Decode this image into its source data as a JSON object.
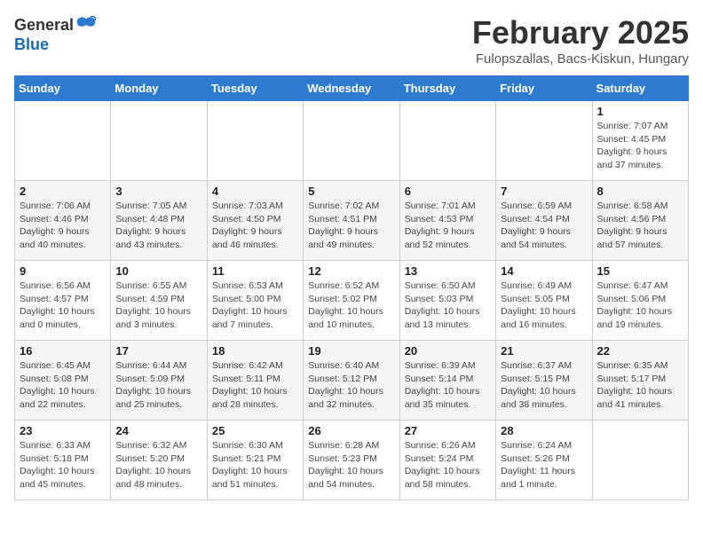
{
  "header": {
    "logo_general": "General",
    "logo_blue": "Blue",
    "month": "February 2025",
    "location": "Fulopszallas, Bacs-Kiskun, Hungary"
  },
  "weekdays": [
    "Sunday",
    "Monday",
    "Tuesday",
    "Wednesday",
    "Thursday",
    "Friday",
    "Saturday"
  ],
  "weeks": [
    [
      {
        "day": "",
        "info": ""
      },
      {
        "day": "",
        "info": ""
      },
      {
        "day": "",
        "info": ""
      },
      {
        "day": "",
        "info": ""
      },
      {
        "day": "",
        "info": ""
      },
      {
        "day": "",
        "info": ""
      },
      {
        "day": "1",
        "info": "Sunrise: 7:07 AM\nSunset: 4:45 PM\nDaylight: 9 hours\nand 37 minutes."
      }
    ],
    [
      {
        "day": "2",
        "info": "Sunrise: 7:06 AM\nSunset: 4:46 PM\nDaylight: 9 hours\nand 40 minutes."
      },
      {
        "day": "3",
        "info": "Sunrise: 7:05 AM\nSunset: 4:48 PM\nDaylight: 9 hours\nand 43 minutes."
      },
      {
        "day": "4",
        "info": "Sunrise: 7:03 AM\nSunset: 4:50 PM\nDaylight: 9 hours\nand 46 minutes."
      },
      {
        "day": "5",
        "info": "Sunrise: 7:02 AM\nSunset: 4:51 PM\nDaylight: 9 hours\nand 49 minutes."
      },
      {
        "day": "6",
        "info": "Sunrise: 7:01 AM\nSunset: 4:53 PM\nDaylight: 9 hours\nand 52 minutes."
      },
      {
        "day": "7",
        "info": "Sunrise: 6:59 AM\nSunset: 4:54 PM\nDaylight: 9 hours\nand 54 minutes."
      },
      {
        "day": "8",
        "info": "Sunrise: 6:58 AM\nSunset: 4:56 PM\nDaylight: 9 hours\nand 57 minutes."
      }
    ],
    [
      {
        "day": "9",
        "info": "Sunrise: 6:56 AM\nSunset: 4:57 PM\nDaylight: 10 hours\nand 0 minutes."
      },
      {
        "day": "10",
        "info": "Sunrise: 6:55 AM\nSunset: 4:59 PM\nDaylight: 10 hours\nand 3 minutes."
      },
      {
        "day": "11",
        "info": "Sunrise: 6:53 AM\nSunset: 5:00 PM\nDaylight: 10 hours\nand 7 minutes."
      },
      {
        "day": "12",
        "info": "Sunrise: 6:52 AM\nSunset: 5:02 PM\nDaylight: 10 hours\nand 10 minutes."
      },
      {
        "day": "13",
        "info": "Sunrise: 6:50 AM\nSunset: 5:03 PM\nDaylight: 10 hours\nand 13 minutes."
      },
      {
        "day": "14",
        "info": "Sunrise: 6:49 AM\nSunset: 5:05 PM\nDaylight: 10 hours\nand 16 minutes."
      },
      {
        "day": "15",
        "info": "Sunrise: 6:47 AM\nSunset: 5:06 PM\nDaylight: 10 hours\nand 19 minutes."
      }
    ],
    [
      {
        "day": "16",
        "info": "Sunrise: 6:45 AM\nSunset: 5:08 PM\nDaylight: 10 hours\nand 22 minutes."
      },
      {
        "day": "17",
        "info": "Sunrise: 6:44 AM\nSunset: 5:09 PM\nDaylight: 10 hours\nand 25 minutes."
      },
      {
        "day": "18",
        "info": "Sunrise: 6:42 AM\nSunset: 5:11 PM\nDaylight: 10 hours\nand 28 minutes."
      },
      {
        "day": "19",
        "info": "Sunrise: 6:40 AM\nSunset: 5:12 PM\nDaylight: 10 hours\nand 32 minutes."
      },
      {
        "day": "20",
        "info": "Sunrise: 6:39 AM\nSunset: 5:14 PM\nDaylight: 10 hours\nand 35 minutes."
      },
      {
        "day": "21",
        "info": "Sunrise: 6:37 AM\nSunset: 5:15 PM\nDaylight: 10 hours\nand 38 minutes."
      },
      {
        "day": "22",
        "info": "Sunrise: 6:35 AM\nSunset: 5:17 PM\nDaylight: 10 hours\nand 41 minutes."
      }
    ],
    [
      {
        "day": "23",
        "info": "Sunrise: 6:33 AM\nSunset: 5:18 PM\nDaylight: 10 hours\nand 45 minutes."
      },
      {
        "day": "24",
        "info": "Sunrise: 6:32 AM\nSunset: 5:20 PM\nDaylight: 10 hours\nand 48 minutes."
      },
      {
        "day": "25",
        "info": "Sunrise: 6:30 AM\nSunset: 5:21 PM\nDaylight: 10 hours\nand 51 minutes."
      },
      {
        "day": "26",
        "info": "Sunrise: 6:28 AM\nSunset: 5:23 PM\nDaylight: 10 hours\nand 54 minutes."
      },
      {
        "day": "27",
        "info": "Sunrise: 6:26 AM\nSunset: 5:24 PM\nDaylight: 10 hours\nand 58 minutes."
      },
      {
        "day": "28",
        "info": "Sunrise: 6:24 AM\nSunset: 5:26 PM\nDaylight: 11 hours\nand 1 minute."
      },
      {
        "day": "",
        "info": ""
      }
    ]
  ]
}
